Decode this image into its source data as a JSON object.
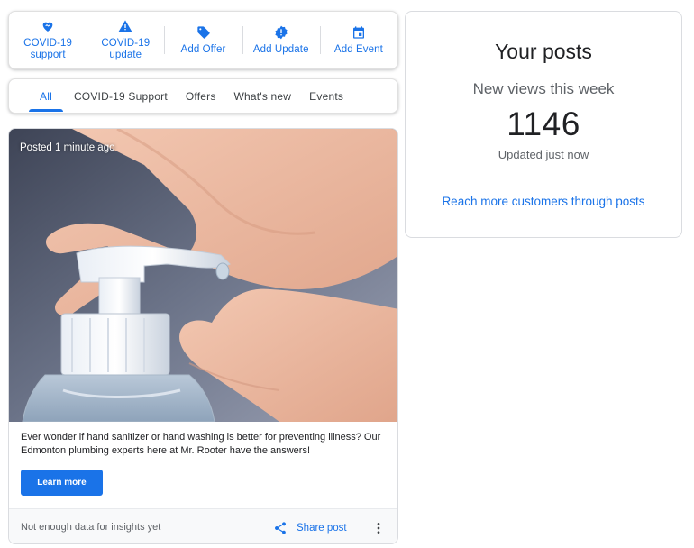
{
  "actions": [
    {
      "label": "COVID-19 support",
      "icon": "heart-hands-icon"
    },
    {
      "label": "COVID-19 update",
      "icon": "warning-icon"
    },
    {
      "label": "Add Offer",
      "icon": "tag-icon"
    },
    {
      "label": "Add Update",
      "icon": "alert-badge-icon"
    },
    {
      "label": "Add Event",
      "icon": "calendar-icon"
    }
  ],
  "tabs": [
    {
      "label": "All",
      "active": true
    },
    {
      "label": "COVID-19 Support",
      "active": false
    },
    {
      "label": "Offers",
      "active": false
    },
    {
      "label": "What's new",
      "active": false
    },
    {
      "label": "Events",
      "active": false
    }
  ],
  "post": {
    "posted_time": "Posted 1 minute ago",
    "text": "Ever wonder if hand sanitizer or hand washing is better for preventing illness? Our Edmonton plumbing experts here at Mr. Rooter have the answers!",
    "button_label": "Learn more",
    "insights": "Not enough data for insights yet",
    "share_label": "Share post"
  },
  "your_posts": {
    "title": "Your posts",
    "subtitle": "New views this week",
    "count": "1146",
    "updated": "Updated just now",
    "link": "Reach more customers through posts"
  },
  "colors": {
    "accent": "#1a73e8",
    "text": "#202124",
    "secondary": "#5f6368"
  }
}
